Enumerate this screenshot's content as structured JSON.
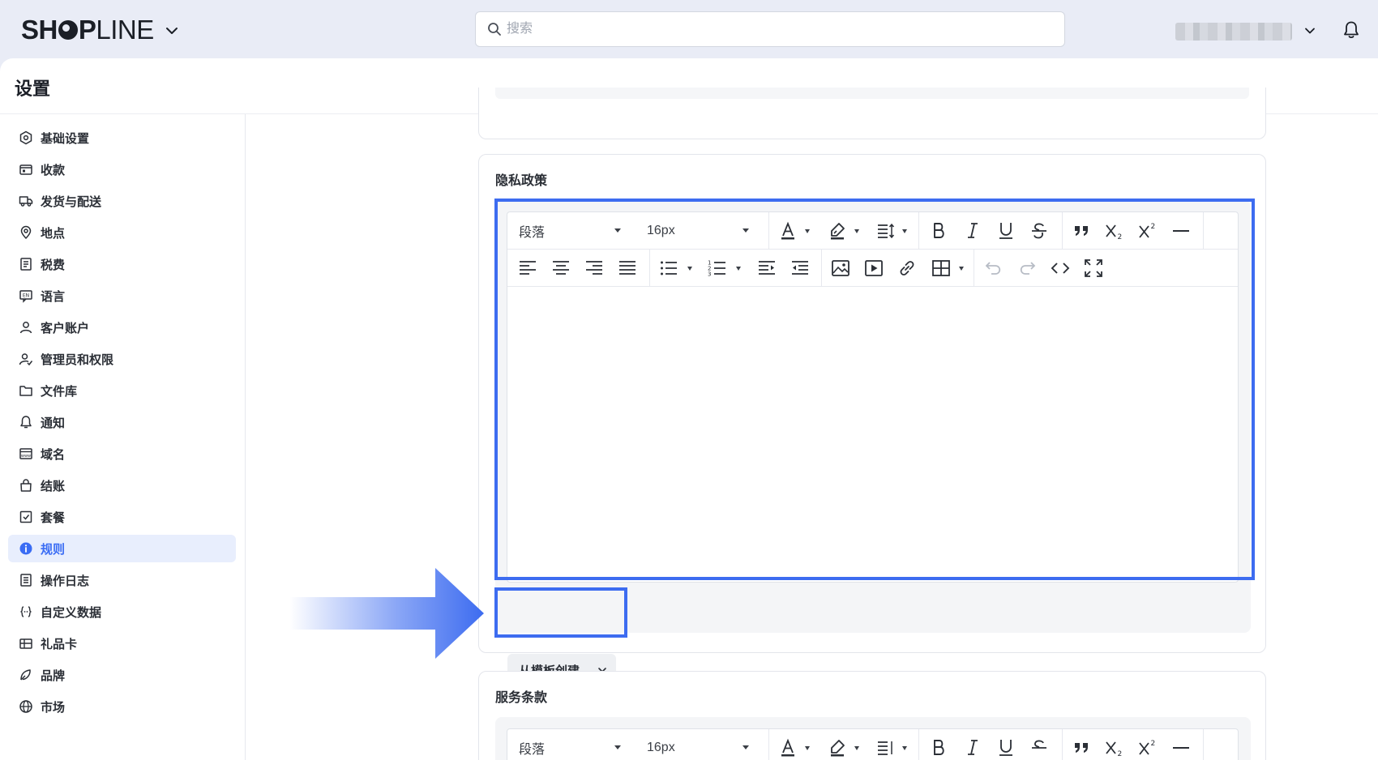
{
  "header": {
    "logo_text": "SHOPLINE",
    "search_placeholder": "搜索"
  },
  "page": {
    "title": "设置"
  },
  "sidebar": {
    "items": [
      {
        "label": "基础设置",
        "icon": "gear-hex-icon"
      },
      {
        "label": "收款",
        "icon": "wallet-icon"
      },
      {
        "label": "发货与配送",
        "icon": "truck-icon"
      },
      {
        "label": "地点",
        "icon": "location-pin-icon"
      },
      {
        "label": "税费",
        "icon": "receipt-icon"
      },
      {
        "label": "语言",
        "icon": "language-icon"
      },
      {
        "label": "客户账户",
        "icon": "user-icon"
      },
      {
        "label": "管理员和权限",
        "icon": "user-permission-icon"
      },
      {
        "label": "文件库",
        "icon": "folder-icon"
      },
      {
        "label": "通知",
        "icon": "bell-icon"
      },
      {
        "label": "域名",
        "icon": "domain-icon"
      },
      {
        "label": "结账",
        "icon": "bag-icon"
      },
      {
        "label": "套餐",
        "icon": "plan-icon"
      },
      {
        "label": "规则",
        "icon": "info-icon",
        "active": true
      },
      {
        "label": "操作日志",
        "icon": "log-icon"
      },
      {
        "label": "自定义数据",
        "icon": "braces-icon"
      },
      {
        "label": "礼品卡",
        "icon": "gift-card-icon"
      },
      {
        "label": "品牌",
        "icon": "brand-icon"
      },
      {
        "label": "市场",
        "icon": "globe-icon"
      }
    ]
  },
  "sections": {
    "privacy": {
      "title": "隐私政策",
      "paragraph_select": "段落",
      "fontsize_select": "16px",
      "template_button": "从模板创建"
    },
    "terms": {
      "title": "服务条款",
      "paragraph_select": "段落",
      "fontsize_select": "16px"
    }
  },
  "colors": {
    "accent": "#3a6cf4",
    "highlight_border": "#3d6cf0",
    "active_nav_bg": "#e8eefd"
  }
}
